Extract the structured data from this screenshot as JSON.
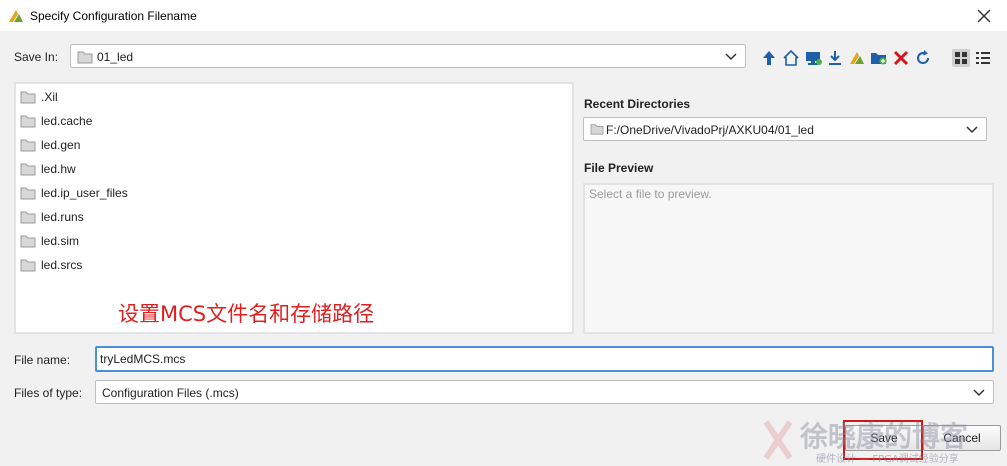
{
  "window": {
    "title": "Specify Configuration Filename",
    "close_icon": "close-icon"
  },
  "toolbar": {
    "save_in_label": "Save In:",
    "current_folder": "01_led",
    "icons": [
      "up-folder-icon",
      "home-icon",
      "desktop-icon",
      "download-icon",
      "vivado-project-icon",
      "new-folder-icon",
      "delete-icon",
      "refresh-icon",
      "grid-view-icon",
      "list-view-icon"
    ]
  },
  "files": [
    {
      "name": ".Xil"
    },
    {
      "name": "led.cache"
    },
    {
      "name": "led.gen"
    },
    {
      "name": "led.hw"
    },
    {
      "name": "led.ip_user_files"
    },
    {
      "name": "led.runs"
    },
    {
      "name": "led.sim"
    },
    {
      "name": "led.srcs"
    }
  ],
  "annotation": "设置MCS文件名和存储路径",
  "recent": {
    "label": "Recent Directories",
    "value": "F:/OneDrive/VivadoPrj/AXKU04/01_led"
  },
  "preview": {
    "label": "File Preview",
    "placeholder": "Select a file to preview."
  },
  "filename": {
    "label": "File name:",
    "value": "tryLedMCS.mcs"
  },
  "filetype": {
    "label": "Files of type:",
    "value": "Configuration Files (.mcs)"
  },
  "buttons": {
    "save": "Save",
    "cancel": "Cancel"
  },
  "watermark": {
    "brand": "徐晓康的博客",
    "tagline": "硬件设计 — FPGA调试经验分享"
  },
  "colors": {
    "accent": "#1d5fa8",
    "highlight": "#d01818",
    "focus": "#4a90d9"
  }
}
